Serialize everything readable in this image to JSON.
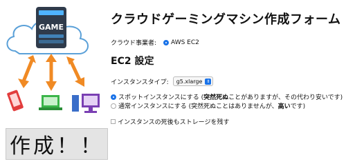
{
  "illustration": {
    "server_label": "GAME"
  },
  "form": {
    "title": "クラウドゲーミングマシン作成フォーム",
    "provider": {
      "label": "クラウド事業者:",
      "selected": "AWS EC2"
    },
    "section_title": "EC2 設定",
    "instance_type": {
      "label": "インスタンスタイプ:",
      "value": "g5.xlarge"
    },
    "options": [
      {
        "pre": "スポットインスタンスにする (",
        "bold": "突然死ぬ",
        "post": "ことがありますが、その代わり安いです)",
        "selected": true
      },
      {
        "pre": "通常インスタンスにする (突然死ぬことはありませんが、",
        "bold": "高い",
        "post": "です)",
        "selected": false
      }
    ],
    "persist_storage": {
      "label": "インスタンスの死後もストレージを残す",
      "checked": false
    },
    "submit_label": "作成！！"
  },
  "colors": {
    "accent": "#1a73e8",
    "button_bg": "#e4e4e4",
    "server": "#2f3b4b",
    "cloud_outline": "#5aa0d8",
    "arrow": "#f08a24"
  }
}
